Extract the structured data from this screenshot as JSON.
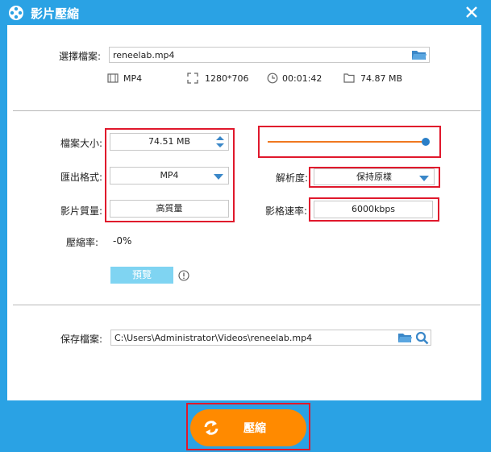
{
  "window": {
    "title": "影片壓縮"
  },
  "file": {
    "label": "選擇檔案:",
    "value": "reneelab.mp4",
    "format": "MP4",
    "resolution": "1280*706",
    "duration": "00:01:42",
    "size": "74.87 MB"
  },
  "settings": {
    "file_size_label": "檔案大小:",
    "file_size_value": "74.51 MB",
    "export_format_label": "匯出格式:",
    "export_format_value": "MP4",
    "quality_label": "影片質量:",
    "quality_value": "高質量",
    "resolution_label": "解析度:",
    "resolution_value": "保持原樣",
    "bitrate_label": "影格速率:",
    "bitrate_value": "6000kbps",
    "ratio_label": "壓縮率:",
    "ratio_value": "-0%",
    "size_slider_fraction": 1.0
  },
  "preview": {
    "label": "預覽"
  },
  "save": {
    "label": "保存檔案:",
    "path": "C:\\Users\\Administrator\\Videos\\reneelab.mp4"
  },
  "compress": {
    "label": "壓縮"
  },
  "colors": {
    "accent": "#2aa2e4",
    "orange": "#ff8a00",
    "highlight": "#e0182c",
    "slider": "#f07820"
  }
}
